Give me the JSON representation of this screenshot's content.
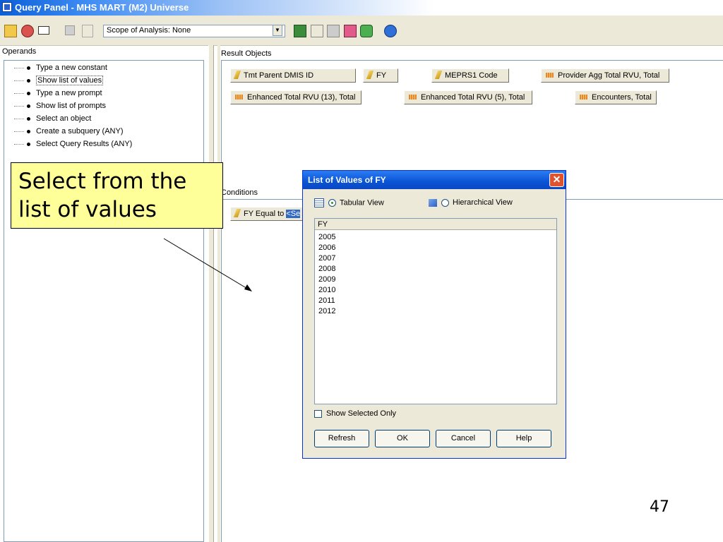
{
  "window": {
    "title": "Query Panel - MHS MART (M2) Universe"
  },
  "toolbar": {
    "scope_label": "Scope of Analysis: None"
  },
  "operands": {
    "header": "Operands",
    "items": [
      "Type a new constant",
      "Show list of values",
      "Type a new prompt",
      "Show list of prompts",
      "Select an object",
      "Create a subquery (ANY)",
      "Select Query Results (ANY)"
    ]
  },
  "result_objects": {
    "header": "Result Objects",
    "chips": [
      {
        "label": "Tmt Parent DMIS ID",
        "kind": "dimension"
      },
      {
        "label": "FY",
        "kind": "dimension"
      },
      {
        "label": "MEPRS1 Code",
        "kind": "dimension"
      },
      {
        "label": "Provider Agg Total RVU, Total",
        "kind": "measure"
      },
      {
        "label": "Enhanced Total RVU (13), Total",
        "kind": "measure"
      },
      {
        "label": "Enhanced Total RVU (5), Total",
        "kind": "measure"
      },
      {
        "label": "Encounters, Total",
        "kind": "measure"
      }
    ]
  },
  "conditions": {
    "header": "Conditions",
    "filter_prefix": "FY Equal to",
    "filter_value": "<Se"
  },
  "callout": {
    "text": "Select from the list of values"
  },
  "dialog": {
    "title": "List of Values of FY",
    "tabular_label": "Tabular View",
    "hierarchical_label": "Hierarchical View",
    "column_header": "FY",
    "values": [
      "2005",
      "2006",
      "2007",
      "2008",
      "2009",
      "2010",
      "2011",
      "2012"
    ],
    "show_selected_label": "Show Selected Only",
    "buttons": {
      "refresh": "Refresh",
      "ok": "OK",
      "cancel": "Cancel",
      "help": "Help"
    }
  },
  "slide": {
    "page_number": "47"
  }
}
